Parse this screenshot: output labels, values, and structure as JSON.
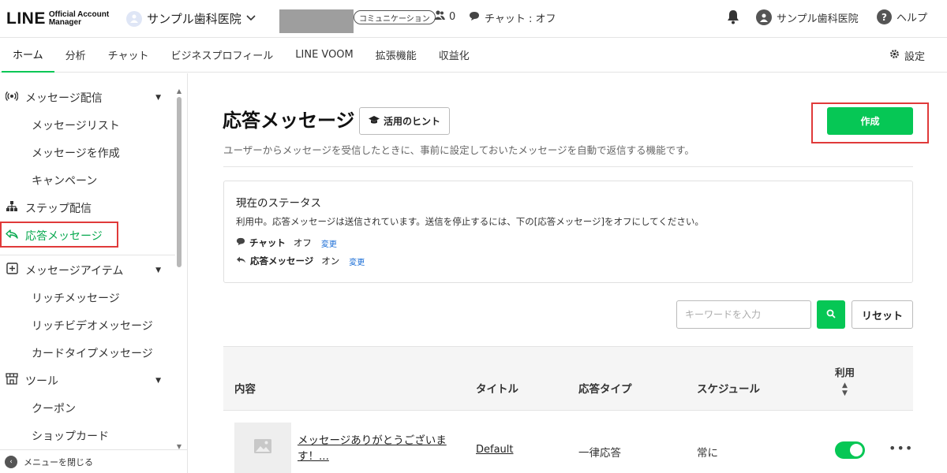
{
  "header": {
    "logo_main": "LINE",
    "logo_sub_1": "Official Account",
    "logo_sub_2": "Manager",
    "account_name": "サンプル歯科医院",
    "plan_badge": "コミュニケーション",
    "friends_count": "0",
    "chat_status": "チャット : オフ",
    "user_name": "サンプル歯科医院",
    "help_label": "ヘルプ"
  },
  "nav": {
    "tabs": [
      {
        "label": "ホーム"
      },
      {
        "label": "分析"
      },
      {
        "label": "チャット"
      },
      {
        "label": "ビジネスプロフィール"
      },
      {
        "label": "LINE VOOM"
      },
      {
        "label": "拡張機能"
      },
      {
        "label": "収益化"
      }
    ],
    "active_tab": "ホーム",
    "settings_label": "設定"
  },
  "sidebar": {
    "items": [
      {
        "label": "メッセージ配信"
      },
      {
        "label": "メッセージリスト"
      },
      {
        "label": "メッセージを作成"
      },
      {
        "label": "キャンペーン"
      },
      {
        "label": "ステップ配信"
      },
      {
        "label": "応答メッセージ"
      },
      {
        "label": "メッセージアイテム"
      },
      {
        "label": "リッチメッセージ"
      },
      {
        "label": "リッチビデオメッセージ"
      },
      {
        "label": "カードタイプメッセージ"
      },
      {
        "label": "ツール"
      },
      {
        "label": "クーポン"
      },
      {
        "label": "ショップカード"
      }
    ],
    "active_item": "応答メッセージ",
    "close_menu_label": "メニューを閉じる"
  },
  "main": {
    "title": "応答メッセージ",
    "hint_button": "活用のヒント",
    "create_button": "作成",
    "description": "ユーザーからメッセージを受信したときに、事前に設定しておいたメッセージを自動で返信する機能です。",
    "status": {
      "title": "現在のステータス",
      "text": "利用中。応答メッセージは送信されています。送信を停止するには、下の[応答メッセージ]をオフにしてください。",
      "chat_label": "チャット",
      "chat_value": "オフ",
      "response_label": "応答メッセージ",
      "response_value": "オン",
      "change_link": "変更"
    },
    "search": {
      "placeholder": "キーワードを入力",
      "reset_button": "リセット"
    },
    "table": {
      "headers": {
        "content": "内容",
        "title": "タイトル",
        "type": "応答タイプ",
        "schedule": "スケジュール",
        "use": "利用"
      },
      "rows": [
        {
          "content": "メッセージありがとうございます！...",
          "title": "Default",
          "type": "一律応答",
          "schedule": "常に",
          "enabled": true
        }
      ]
    }
  },
  "colors": {
    "brand_green": "#06c755",
    "highlight_red": "#e03a3a",
    "link_blue": "#1a6dd6"
  }
}
